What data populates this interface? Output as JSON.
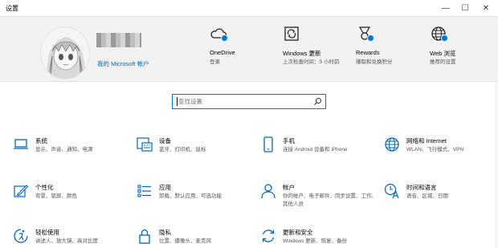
{
  "window": {
    "title": "设置",
    "minimize": "—",
    "maximize": "☐",
    "close": "✕"
  },
  "account": {
    "link": "我的 Microsoft 帐户"
  },
  "header_items": [
    {
      "title": "OneDrive",
      "sub": "登录",
      "icon": "cloud-icon"
    },
    {
      "title": "Windows 更新",
      "sub": "上次检查时间：5 小时前",
      "icon": "sync-icon"
    },
    {
      "title": "Rewards",
      "sub": "赚取和兑换积分",
      "icon": "medal-icon"
    },
    {
      "title": "Web 浏览",
      "sub": "推荐的设置",
      "icon": "globe-icon"
    }
  ],
  "search": {
    "placeholder": "查找设置"
  },
  "tiles": [
    {
      "title": "系统",
      "desc": "显示、声音、通知、电源",
      "icon": "laptop-icon"
    },
    {
      "title": "设备",
      "desc": "蓝牙、打印机、鼠标",
      "icon": "keyboard-icon"
    },
    {
      "title": "手机",
      "desc": "连接 Android 设备和 iPhone",
      "icon": "phone-icon"
    },
    {
      "title": "网络和 Internet",
      "desc": "WLAN、飞行模式、VPN",
      "icon": "globe-icon"
    },
    {
      "title": "个性化",
      "desc": "背景、锁屏、颜色",
      "icon": "paint-icon"
    },
    {
      "title": "应用",
      "desc": "卸载、默认应用、可选功能",
      "icon": "apps-list-icon"
    },
    {
      "title": "帐户",
      "desc": "你的帐户、电子邮件、同步设置、工作、其他人员",
      "icon": "person-icon"
    },
    {
      "title": "时间和语言",
      "desc": "语音、区域、日期",
      "icon": "language-icon"
    },
    {
      "title": "轻松使用",
      "desc": "讲述人、放大镜、高对比度",
      "icon": "accessibility-icon"
    },
    {
      "title": "隐私",
      "desc": "位置、摄像头、麦克风",
      "icon": "lock-icon"
    },
    {
      "title": "更新和安全",
      "desc": "Windows 更新、恢复、备份",
      "icon": "update-icon"
    }
  ],
  "colors": {
    "accent": "#0078d7",
    "header_bg": "#f2f2f2",
    "icon": "#0067c0"
  }
}
